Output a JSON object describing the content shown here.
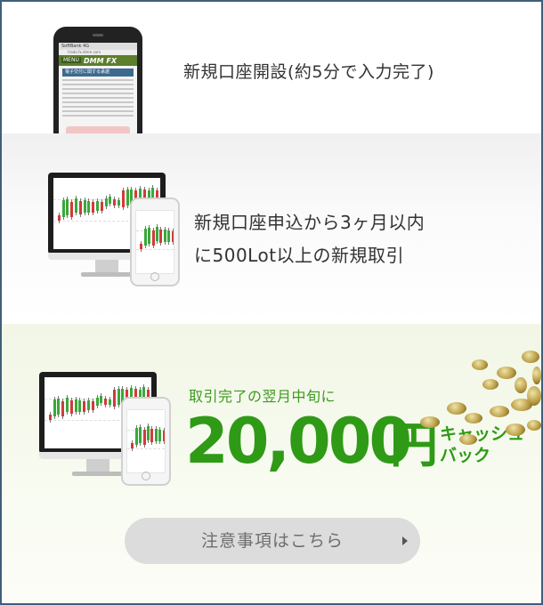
{
  "steps": {
    "step1": {
      "text": "新規口座開設(約5分で入力完了)"
    },
    "step2": {
      "line1": "新規口座申込から3ヶ月以内",
      "line2": "に500Lot以上の新規取引"
    },
    "step3": {
      "lead": "取引完了の翌月中旬に",
      "amount": "20,000",
      "currency": "円",
      "cashback_line1": "キャッシュ",
      "cashback_line2": "バック"
    }
  },
  "phone_mock": {
    "brand": "DMM FX",
    "menu": "MENU",
    "banner": "電子交付に関する承諾"
  },
  "notice_button": {
    "label": "注意事項はこちら"
  },
  "colors": {
    "accent_green": "#2f9a16",
    "border": "#3f5f7a",
    "button_bg": "#dcdcdc"
  }
}
